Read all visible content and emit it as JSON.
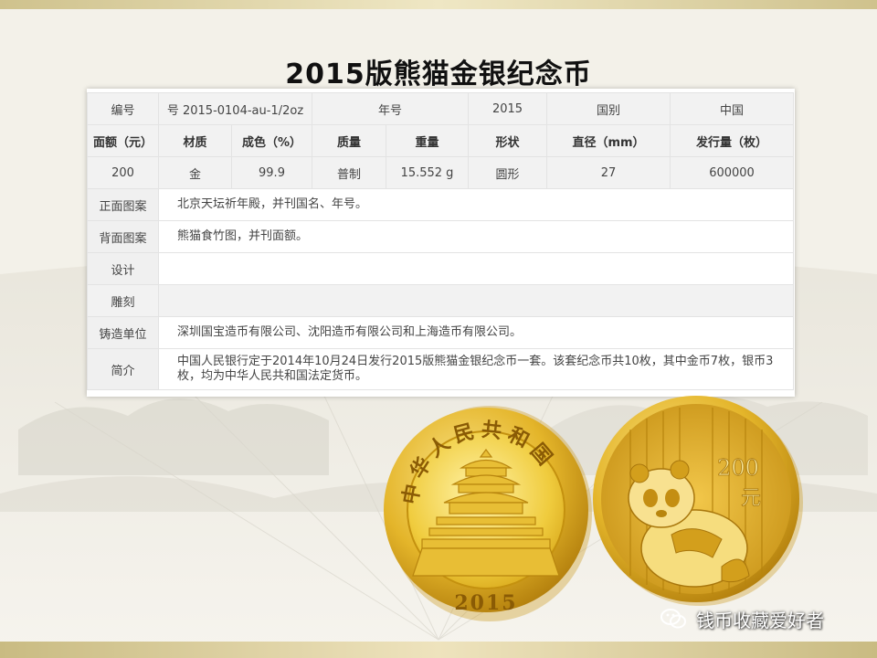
{
  "title": "2015版熊猫金银纪念币",
  "table": {
    "row1": [
      "编号",
      "号 2015-0104-au-1/2oz",
      "年号",
      "2015",
      "国别",
      "中国"
    ],
    "headers": [
      "面额（元）",
      "材质",
      "成色（%）",
      "质量",
      "重量",
      "形状",
      "直径（mm）",
      "发行量（枚）"
    ],
    "values": [
      "200",
      "金",
      "99.9",
      "普制",
      "15.552 g",
      "圆形",
      "27",
      "600000"
    ],
    "front": {
      "label": "正面图案",
      "value": "北京天坛祈年殿，并刊国名、年号。"
    },
    "back": {
      "label": "背面图案",
      "value": "熊猫食竹图，并刊面额。"
    },
    "design": {
      "label": "设计",
      "value": ""
    },
    "engrave": {
      "label": "雕刻",
      "value": ""
    },
    "mint": {
      "label": "铸造单位",
      "value": "深圳国宝造币有限公司、沈阳造币有限公司和上海造币有限公司。"
    },
    "intro": {
      "label": "简介",
      "value": "中国人民银行定于2014年10月24日发行2015版熊猫金银纪念币一套。该套纪念币共10枚，其中金币7枚，银币3枚，均为中华人民共和国法定货币。"
    }
  },
  "coin_front": {
    "legend": "中华人民共和国",
    "year": "2015"
  },
  "coin_back": {
    "denomination": "200",
    "unit": "元"
  },
  "watermark": "钱币收藏爱好者",
  "colors": {
    "gold": "#e2b21c",
    "gold_light": "#f7dc6a",
    "gold_dark": "#a9740a"
  }
}
